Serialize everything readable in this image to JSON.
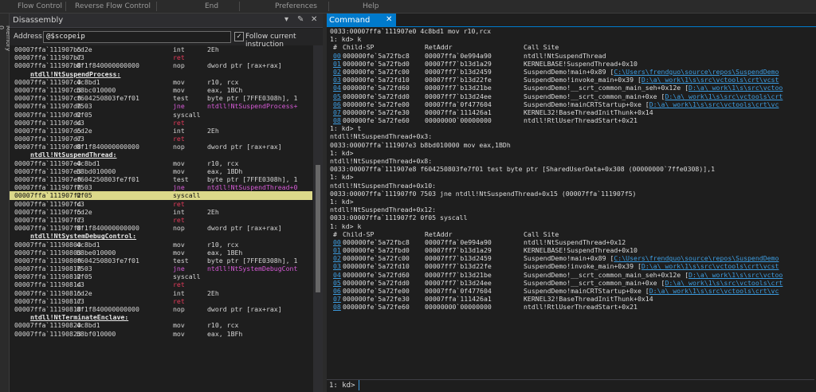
{
  "ribbon": [
    "Flow Control",
    "Reverse Flow Control",
    "End",
    "Preferences",
    "Help"
  ],
  "left_strip": "Memory 0",
  "disassembly": {
    "title": "Disassembly",
    "address_label": "Address:",
    "address_value": "@$scopeip",
    "follow_label": "Follow current instruction",
    "follow_checked": true,
    "rows": [
      {
        "t": "ins",
        "a": "00007ffa`111907b5",
        "b": "cd2e",
        "m": "int",
        "o": "2Eh"
      },
      {
        "t": "ret",
        "a": "00007ffa`111907b7",
        "b": "c3",
        "m": "ret",
        "o": ""
      },
      {
        "t": "ins",
        "a": "00007ffa`111907b8",
        "b": "0f1f840000000000",
        "m": "nop",
        "o": "dword ptr [rax+rax]"
      },
      {
        "t": "sym",
        "s": "ntdll!NtSuspendProcess:"
      },
      {
        "t": "ins",
        "a": "00007ffa`111907c0",
        "b": "4c8bd1",
        "m": "mov",
        "o": "r10, rcx"
      },
      {
        "t": "ins",
        "a": "00007ffa`111907c3",
        "b": "b8bc010000",
        "m": "mov",
        "o": "eax, 1BCh"
      },
      {
        "t": "ins",
        "a": "00007ffa`111907c8",
        "b": "f604250803fe7f01",
        "m": "test",
        "o": "byte ptr [7FFE0308h], 1"
      },
      {
        "t": "jne",
        "a": "00007ffa`111907d0",
        "b": "7503",
        "m": "jne",
        "o": "ntdll!NtSuspendProcess+"
      },
      {
        "t": "ins",
        "a": "00007ffa`111907d2",
        "b": "0f05",
        "m": "syscall",
        "o": ""
      },
      {
        "t": "ret",
        "a": "00007ffa`111907d4",
        "b": "c3",
        "m": "ret",
        "o": ""
      },
      {
        "t": "ins",
        "a": "00007ffa`111907d5",
        "b": "cd2e",
        "m": "int",
        "o": "2Eh"
      },
      {
        "t": "ret",
        "a": "00007ffa`111907d7",
        "b": "c3",
        "m": "ret",
        "o": ""
      },
      {
        "t": "ins",
        "a": "00007ffa`111907d8",
        "b": "0f1f840000000000",
        "m": "nop",
        "o": "dword ptr [rax+rax]"
      },
      {
        "t": "sym",
        "s": "ntdll!NtSuspendThread:"
      },
      {
        "t": "ins",
        "a": "00007ffa`111907e0",
        "b": "4c8bd1",
        "m": "mov",
        "o": "r10, rcx"
      },
      {
        "t": "ins",
        "a": "00007ffa`111907e3",
        "b": "b8bd010000",
        "m": "mov",
        "o": "eax, 1BDh"
      },
      {
        "t": "ins",
        "a": "00007ffa`111907e8",
        "b": "f604250803fe7f01",
        "m": "test",
        "o": "byte ptr [7FFE0308h], 1"
      },
      {
        "t": "jne",
        "a": "00007ffa`111907f0",
        "b": "7503",
        "m": "jne",
        "o": "ntdll!NtSuspendThread+0"
      },
      {
        "t": "hl",
        "a": "00007ffa`111907f2",
        "b": "0f05",
        "m": "syscall",
        "o": ""
      },
      {
        "t": "ret",
        "a": "00007ffa`111907f4",
        "b": "c3",
        "m": "ret",
        "o": ""
      },
      {
        "t": "ins",
        "a": "00007ffa`111907f5",
        "b": "cd2e",
        "m": "int",
        "o": "2Eh"
      },
      {
        "t": "ret",
        "a": "00007ffa`111907f7",
        "b": "c3",
        "m": "ret",
        "o": ""
      },
      {
        "t": "ins",
        "a": "00007ffa`111907f8",
        "b": "0f1f840000000000",
        "m": "nop",
        "o": "dword ptr [rax+rax]"
      },
      {
        "t": "sym",
        "s": "ntdll!NtSystemDebugControl:"
      },
      {
        "t": "ins",
        "a": "00007ffa`11190800",
        "b": "4c8bd1",
        "m": "mov",
        "o": "r10, rcx"
      },
      {
        "t": "ins",
        "a": "00007ffa`11190803",
        "b": "b8be010000",
        "m": "mov",
        "o": "eax, 1BEh"
      },
      {
        "t": "ins",
        "a": "00007ffa`11190808",
        "b": "f604250803fe7f01",
        "m": "test",
        "o": "byte ptr [7FFE0308h], 1"
      },
      {
        "t": "jne",
        "a": "00007ffa`11190810",
        "b": "7503",
        "m": "jne",
        "o": "ntdll!NtSystemDebugCont"
      },
      {
        "t": "ins",
        "a": "00007ffa`11190812",
        "b": "0f05",
        "m": "syscall",
        "o": ""
      },
      {
        "t": "ret",
        "a": "00007ffa`11190814",
        "b": "c3",
        "m": "ret",
        "o": ""
      },
      {
        "t": "ins",
        "a": "00007ffa`11190815",
        "b": "cd2e",
        "m": "int",
        "o": "2Eh"
      },
      {
        "t": "ret",
        "a": "00007ffa`11190817",
        "b": "c3",
        "m": "ret",
        "o": ""
      },
      {
        "t": "ins",
        "a": "00007ffa`11190818",
        "b": "0f1f840000000000",
        "m": "nop",
        "o": "dword ptr [rax+rax]"
      },
      {
        "t": "sym",
        "s": "ntdll!NtTerminateEnclave:"
      },
      {
        "t": "ins",
        "a": "00007ffa`11190820",
        "b": "4c8bd1",
        "m": "mov",
        "o": "r10, rcx"
      },
      {
        "t": "ins",
        "a": "00007ffa`11190823",
        "b": "b8bf010000",
        "m": "mov",
        "o": "eax, 1BFh"
      }
    ]
  },
  "command": {
    "title": "Command",
    "prompt": "1: kd>",
    "lines": [
      {
        "t": "plain",
        "x": "0033:00007ffa`111907e0 4c8bd1          mov     r10,rcx"
      },
      {
        "t": "plain",
        "x": "1: kd> k"
      },
      {
        "t": "hdr",
        "n": "#",
        "sp": "Child-SP",
        "ra": "RetAddr",
        "cs": "Call Site"
      },
      {
        "t": "frame",
        "n": "00",
        "sp": "000000fe`5a72fbc8",
        "ra": "00007ffa`0e994a90",
        "cs": "ntdll!NtSuspendThread",
        "p": ""
      },
      {
        "t": "frame",
        "n": "01",
        "sp": "000000fe`5a72fbd0",
        "ra": "00007ff7`b13d1a29",
        "cs": "KERNELBASE!SuspendThread+0x10",
        "p": ""
      },
      {
        "t": "frame",
        "n": "02",
        "sp": "000000fe`5a72fc00",
        "ra": "00007ff7`b13d2459",
        "cs": "SuspendDemo!main+0x89 [",
        "p": "C:\\Users\\frendguo\\source\\repos\\SuspendDemo"
      },
      {
        "t": "frame",
        "n": "03",
        "sp": "000000fe`5a72fd10",
        "ra": "00007ff7`b13d22fe",
        "cs": "SuspendDemo!invoke_main+0x39 [",
        "p": "D:\\a\\_work\\1\\s\\src\\vctools\\crt\\vcst"
      },
      {
        "t": "frame",
        "n": "04",
        "sp": "000000fe`5a72fd60",
        "ra": "00007ff7`b13d21be",
        "cs": "SuspendDemo!__scrt_common_main_seh+0x12e [",
        "p": "D:\\a\\_work\\1\\s\\src\\vctoo"
      },
      {
        "t": "frame",
        "n": "05",
        "sp": "000000fe`5a72fdd0",
        "ra": "00007ff7`b13d24ee",
        "cs": "SuspendDemo!__scrt_common_main+0xe [",
        "p": "D:\\a\\_work\\1\\s\\src\\vctools\\crt"
      },
      {
        "t": "frame",
        "n": "06",
        "sp": "000000fe`5a72fe00",
        "ra": "00007ffa`0f477604",
        "cs": "SuspendDemo!mainCRTStartup+0xe [",
        "p": "D:\\a\\_work\\1\\s\\src\\vctools\\crt\\vc"
      },
      {
        "t": "frame",
        "n": "07",
        "sp": "000000fe`5a72fe30",
        "ra": "00007ffa`111426a1",
        "cs": "KERNEL32!BaseThreadInitThunk+0x14",
        "p": ""
      },
      {
        "t": "frame",
        "n": "08",
        "sp": "000000fe`5a72fe60",
        "ra": "00000000`00000000",
        "cs": "ntdll!RtlUserThreadStart+0x21",
        "p": ""
      },
      {
        "t": "plain",
        "x": "1: kd> t"
      },
      {
        "t": "plain",
        "x": "ntdll!NtSuspendThread+0x3:"
      },
      {
        "t": "plain",
        "x": "0033:00007ffa`111907e3 b8bd010000      mov     eax,1BDh"
      },
      {
        "t": "plain",
        "x": "1: kd>"
      },
      {
        "t": "plain",
        "x": "ntdll!NtSuspendThread+0x8:"
      },
      {
        "t": "plain",
        "x": "0033:00007ffa`111907e8 f604250803fe7f01 test    byte ptr [SharedUserData+0x308 (00000000`7ffe0308)],1"
      },
      {
        "t": "plain",
        "x": "1: kd>"
      },
      {
        "t": "plain",
        "x": "ntdll!NtSuspendThread+0x10:"
      },
      {
        "t": "plain",
        "x": "0033:00007ffa`111907f0 7503            jne     ntdll!NtSuspendThread+0x15 (00007ffa`111907f5)"
      },
      {
        "t": "plain",
        "x": "1: kd>"
      },
      {
        "t": "plain",
        "x": "ntdll!NtSuspendThread+0x12:"
      },
      {
        "t": "plain",
        "x": "0033:00007ffa`111907f2 0f05            syscall"
      },
      {
        "t": "plain",
        "x": "1: kd> k"
      },
      {
        "t": "hdr",
        "n": "#",
        "sp": "Child-SP",
        "ra": "RetAddr",
        "cs": "Call Site"
      },
      {
        "t": "frame",
        "n": "00",
        "sp": "000000fe`5a72fbc8",
        "ra": "00007ffa`0e994a90",
        "cs": "ntdll!NtSuspendThread+0x12",
        "p": ""
      },
      {
        "t": "frame",
        "n": "01",
        "sp": "000000fe`5a72fbd0",
        "ra": "00007ff7`b13d1a29",
        "cs": "KERNELBASE!SuspendThread+0x10",
        "p": ""
      },
      {
        "t": "frame",
        "n": "02",
        "sp": "000000fe`5a72fc00",
        "ra": "00007ff7`b13d2459",
        "cs": "SuspendDemo!main+0x89 [",
        "p": "C:\\Users\\frendguo\\source\\repos\\SuspendDemo"
      },
      {
        "t": "frame",
        "n": "03",
        "sp": "000000fe`5a72fd10",
        "ra": "00007ff7`b13d22fe",
        "cs": "SuspendDemo!invoke_main+0x39 [",
        "p": "D:\\a\\_work\\1\\s\\src\\vctools\\crt\\vcst"
      },
      {
        "t": "frame",
        "n": "04",
        "sp": "000000fe`5a72fd60",
        "ra": "00007ff7`b13d21be",
        "cs": "SuspendDemo!__scrt_common_main_seh+0x12e [",
        "p": "D:\\a\\_work\\1\\s\\src\\vctoo"
      },
      {
        "t": "frame",
        "n": "05",
        "sp": "000000fe`5a72fdd0",
        "ra": "00007ff7`b13d24ee",
        "cs": "SuspendDemo!__scrt_common_main+0xe [",
        "p": "D:\\a\\_work\\1\\s\\src\\vctools\\crt"
      },
      {
        "t": "frame",
        "n": "06",
        "sp": "000000fe`5a72fe00",
        "ra": "00007ffa`0f477604",
        "cs": "SuspendDemo!mainCRTStartup+0xe [",
        "p": "D:\\a\\_work\\1\\s\\src\\vctools\\crt\\vc"
      },
      {
        "t": "frame",
        "n": "07",
        "sp": "000000fe`5a72fe30",
        "ra": "00007ffa`111426a1",
        "cs": "KERNEL32!BaseThreadInitThunk+0x14",
        "p": ""
      },
      {
        "t": "frame",
        "n": "08",
        "sp": "000000fe`5a72fe60",
        "ra": "00000000`00000000",
        "cs": "ntdll!RtlUserThreadStart+0x21",
        "p": ""
      }
    ]
  }
}
